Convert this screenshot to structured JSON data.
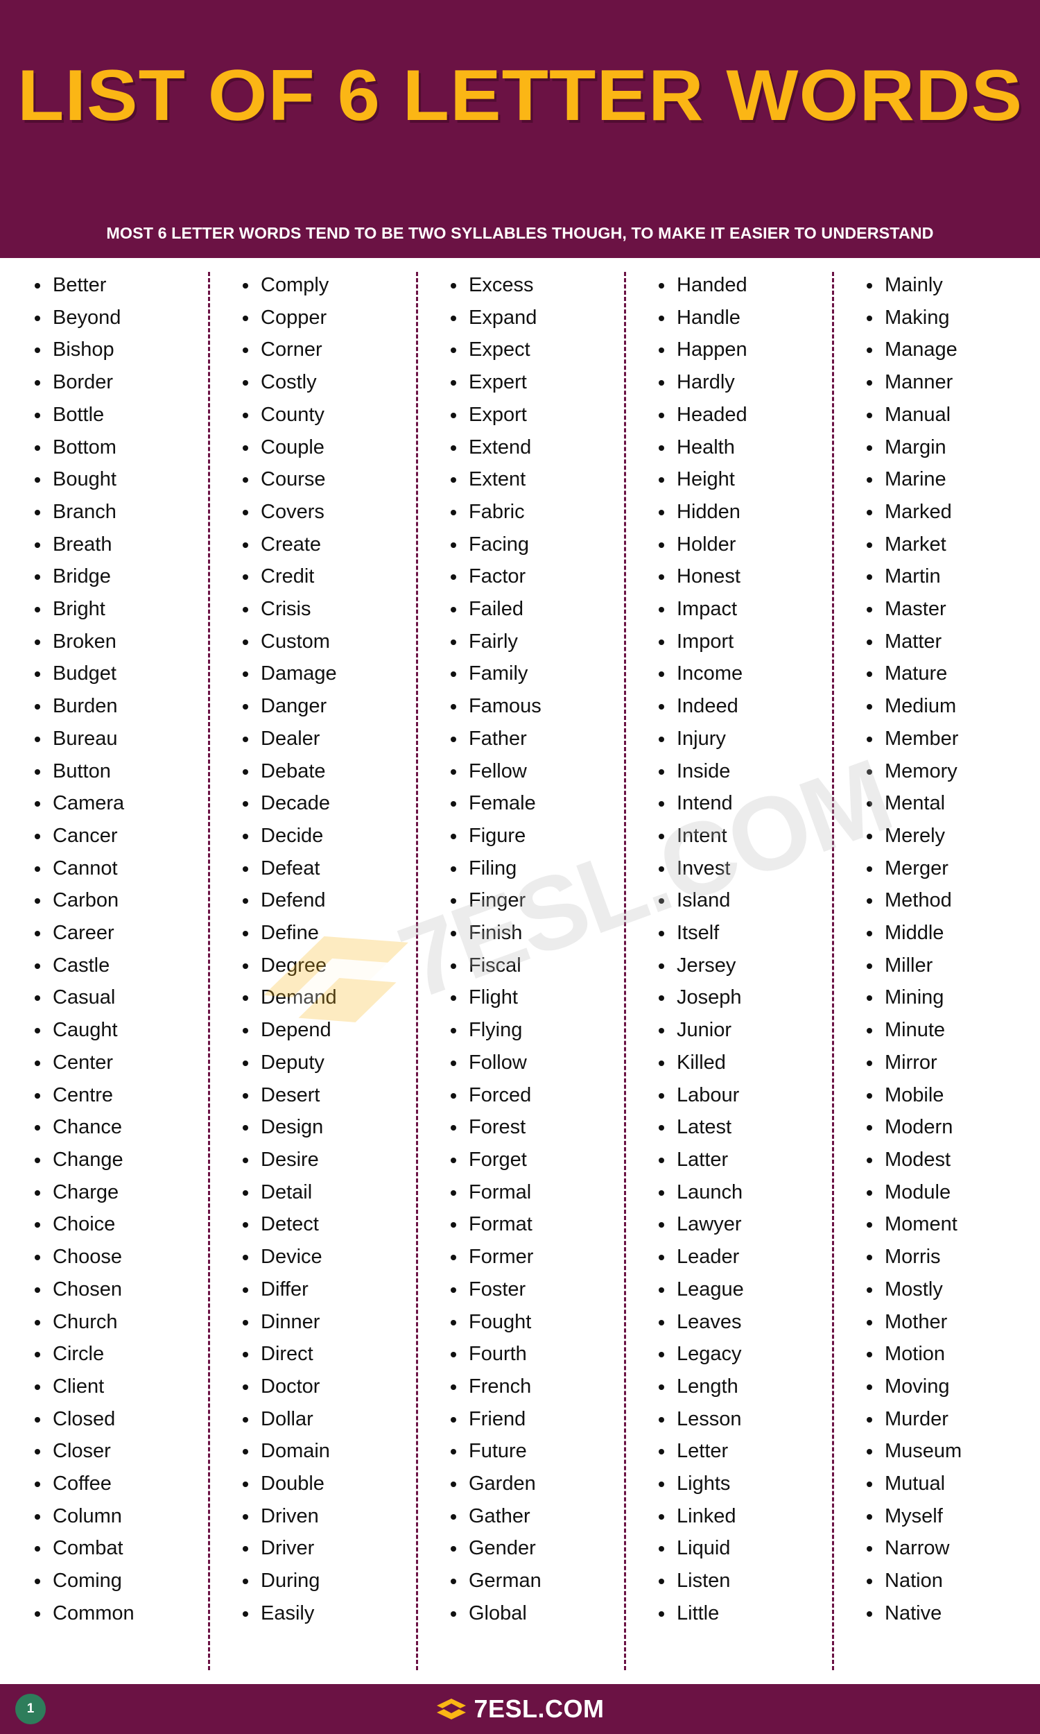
{
  "header": {
    "title": "LIST OF 6 LETTER WORDS",
    "subtitle": "MOST 6 LETTER WORDS TEND TO BE TWO SYLLABLES THOUGH, TO MAKE IT EASIER TO UNDERSTAND",
    "bg_color": "#6B1244",
    "title_color": "#FBB615"
  },
  "watermark": {
    "text": "7ESL.COM",
    "icon": "graduation-cap-icon"
  },
  "columns": [
    {
      "id": "column-1",
      "words": [
        "Better",
        "Beyond",
        "Bishop",
        "Border",
        "Bottle",
        "Bottom",
        "Bought",
        "Branch",
        "Breath",
        "Bridge",
        "Bright",
        "Broken",
        "Budget",
        "Burden",
        "Bureau",
        "Button",
        "Camera",
        "Cancer",
        "Cannot",
        "Carbon",
        "Career",
        "Castle",
        "Casual",
        "Caught",
        "Center",
        "Centre",
        "Chance",
        "Change",
        "Charge",
        "Choice",
        "Choose",
        "Chosen",
        "Church",
        "Circle",
        "Client",
        "Closed",
        "Closer",
        "Coffee",
        "Column",
        "Combat",
        "Coming",
        "Common"
      ]
    },
    {
      "id": "column-2",
      "words": [
        "Comply",
        "Copper",
        "Corner",
        "Costly",
        "County",
        "Couple",
        "Course",
        "Covers",
        "Create",
        "Credit",
        "Crisis",
        "Custom",
        "Damage",
        "Danger",
        "Dealer",
        "Debate",
        "Decade",
        "Decide",
        "Defeat",
        "Defend",
        "Define",
        "Degree",
        "Demand",
        "Depend",
        "Deputy",
        "Desert",
        "Design",
        "Desire",
        "Detail",
        "Detect",
        "Device",
        "Differ",
        "Dinner",
        "Direct",
        "Doctor",
        "Dollar",
        "Domain",
        "Double",
        "Driven",
        "Driver",
        "During",
        "Easily"
      ]
    },
    {
      "id": "column-3",
      "words": [
        "Excess",
        "Expand",
        "Expect",
        "Expert",
        "Export",
        "Extend",
        "Extent",
        "Fabric",
        "Facing",
        "Factor",
        "Failed",
        "Fairly",
        "Family",
        "Famous",
        "Father",
        "Fellow",
        "Female",
        "Figure",
        "Filing",
        "Finger",
        "Finish",
        "Fiscal",
        "Flight",
        "Flying",
        "Follow",
        "Forced",
        "Forest",
        "Forget",
        "Formal",
        "Format",
        "Former",
        "Foster",
        "Fought",
        "Fourth",
        "French",
        "Friend",
        "Future",
        "Garden",
        "Gather",
        "Gender",
        "German",
        "Global"
      ]
    },
    {
      "id": "column-4",
      "words": [
        "Handed",
        "Handle",
        "Happen",
        "Hardly",
        "Headed",
        "Health",
        "Height",
        "Hidden",
        "Holder",
        "Honest",
        "Impact",
        "Import",
        "Income",
        "Indeed",
        "Injury",
        "Inside",
        "Intend",
        "Intent",
        "Invest",
        "Island",
        "Itself",
        "Jersey",
        "Joseph",
        "Junior",
        "Killed",
        "Labour",
        "Latest",
        "Latter",
        "Launch",
        "Lawyer",
        "Leader",
        "League",
        "Leaves",
        "Legacy",
        "Length",
        "Lesson",
        "Letter",
        "Lights",
        "Linked",
        "Liquid",
        "Listen",
        "Little"
      ]
    },
    {
      "id": "column-5",
      "words": [
        "Mainly",
        "Making",
        "Manage",
        "Manner",
        "Manual",
        "Margin",
        "Marine",
        "Marked",
        "Market",
        "Martin",
        "Master",
        "Matter",
        "Mature",
        "Medium",
        "Member",
        "Memory",
        "Mental",
        "Merely",
        "Merger",
        "Method",
        "Middle",
        "Miller",
        "Mining",
        "Minute",
        "Mirror",
        "Mobile",
        "Modern",
        "Modest",
        "Module",
        "Moment",
        "Morris",
        "Mostly",
        "Mother",
        "Motion",
        "Moving",
        "Murder",
        "Museum",
        "Mutual",
        "Myself",
        "Narrow",
        "Nation",
        "Native"
      ]
    }
  ],
  "footer": {
    "brand": "7ESL.COM",
    "page_number": "1",
    "bg_color": "#6B1244",
    "badge_color": "#2E7D5B"
  }
}
